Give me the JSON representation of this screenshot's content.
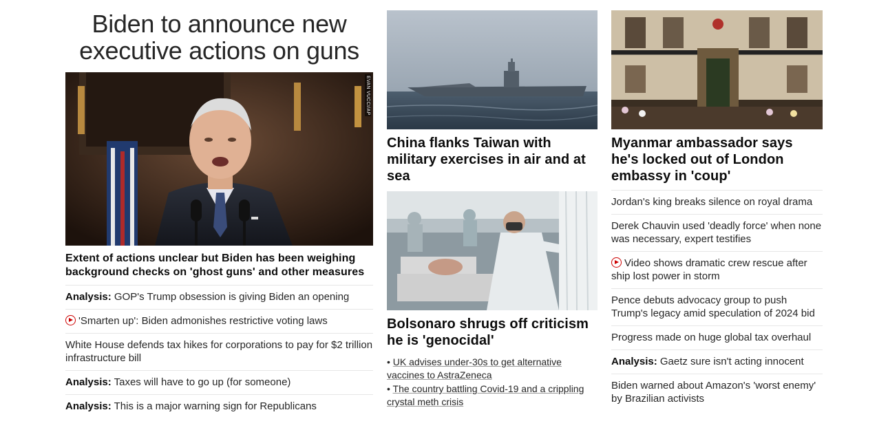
{
  "left": {
    "headline": "Biden to announce new executive actions on guns",
    "image_credit": "EVAN VUCCI/AP",
    "lead_caption": "Extent of actions unclear but Biden has been weighing background checks on 'ghost guns' and other measures",
    "links": [
      {
        "prefix": "Analysis:",
        "text": "GOP's Trump obsession is giving Biden an opening",
        "video": false
      },
      {
        "prefix": "",
        "text": "'Smarten up': Biden admonishes restrictive voting laws",
        "video": true
      },
      {
        "prefix": "",
        "text": "White House defends tax hikes for corporations to pay for $2 trillion infrastructure bill",
        "video": false
      },
      {
        "prefix": "Analysis:",
        "text": "Taxes will have to go up (for someone)",
        "video": false
      },
      {
        "prefix": "Analysis:",
        "text": "This is a major warning sign for Republicans",
        "video": false
      }
    ]
  },
  "middle": {
    "card1_title": "China flanks Taiwan with military exercises in air and at sea",
    "card2_title": "Bolsonaro shrugs off criticism he is 'genocidal'",
    "bullets": [
      "UK advises under-30s to get alternative vaccines to AstraZeneca",
      "The country battling Covid-19 and a crippling crystal meth crisis"
    ]
  },
  "right": {
    "card_title": "Myanmar ambassador says he's locked out of London embassy in 'coup'",
    "links": [
      {
        "prefix": "",
        "text": "Jordan's king breaks silence on royal drama",
        "video": false
      },
      {
        "prefix": "",
        "text": "Derek Chauvin used 'deadly force' when none was necessary, expert testifies",
        "video": false
      },
      {
        "prefix": "",
        "text": "Video shows dramatic crew rescue after ship lost power in storm",
        "video": true
      },
      {
        "prefix": "",
        "text": "Pence debuts advocacy group to push Trump's legacy amid speculation of 2024 bid",
        "video": false
      },
      {
        "prefix": "",
        "text": "Progress made on huge global tax overhaul",
        "video": false
      },
      {
        "prefix": "Analysis:",
        "text": "Gaetz sure isn't acting innocent",
        "video": false
      },
      {
        "prefix": "",
        "text": "Biden warned about Amazon's 'worst enemy' by Brazilian activists",
        "video": false
      }
    ]
  },
  "colors": {
    "accent_red": "#cc0000",
    "text": "#0c0c0c",
    "divider": "#e6e6e6"
  }
}
